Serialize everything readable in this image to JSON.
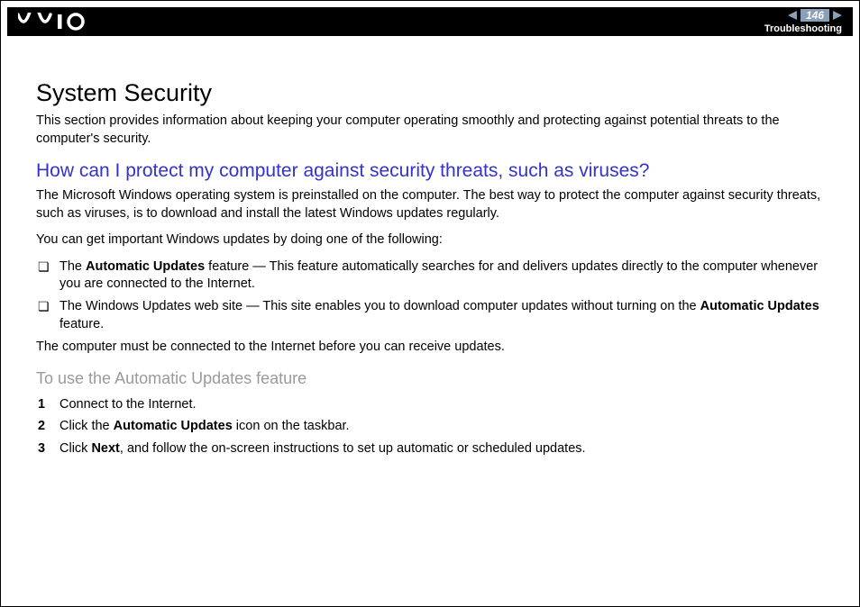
{
  "header": {
    "logo_label": "VAIO",
    "page_number": "146",
    "section": "Troubleshooting"
  },
  "title": "System Security",
  "intro": "This section provides information about keeping your computer operating smoothly and protecting against potential threats to the computer's security.",
  "question": "How can I protect my computer against security threats, such as viruses?",
  "para1": "The Microsoft Windows operating system is preinstalled on the computer. The best way to protect the computer against security threats, such as viruses, is to download and install the latest Windows updates regularly.",
  "para2": "You can get important Windows updates by doing one of the following:",
  "bullets": [
    {
      "prefix": "The ",
      "bold1": "Automatic Updates",
      "mid": " feature — This feature automatically searches for and delivers updates directly to the computer whenever you are connected to the Internet.",
      "bold2": "",
      "suffix": ""
    },
    {
      "prefix": "The Windows Updates web site — This site enables you to download computer updates without turning on the ",
      "bold1": "Automatic Updates",
      "mid": " feature.",
      "bold2": "",
      "suffix": ""
    }
  ],
  "para3": "The computer must be connected to the Internet before you can receive updates.",
  "subheading": "To use the Automatic Updates feature",
  "steps": [
    {
      "num": "1",
      "prefix": "Connect to the Internet.",
      "bold1": "",
      "mid": "",
      "bold2": "",
      "suffix": ""
    },
    {
      "num": "2",
      "prefix": "Click the ",
      "bold1": "Automatic Updates",
      "mid": " icon on the taskbar.",
      "bold2": "",
      "suffix": ""
    },
    {
      "num": "3",
      "prefix": "Click ",
      "bold1": "Next",
      "mid": ", and follow the on-screen instructions to set up automatic or scheduled updates.",
      "bold2": "",
      "suffix": ""
    }
  ]
}
